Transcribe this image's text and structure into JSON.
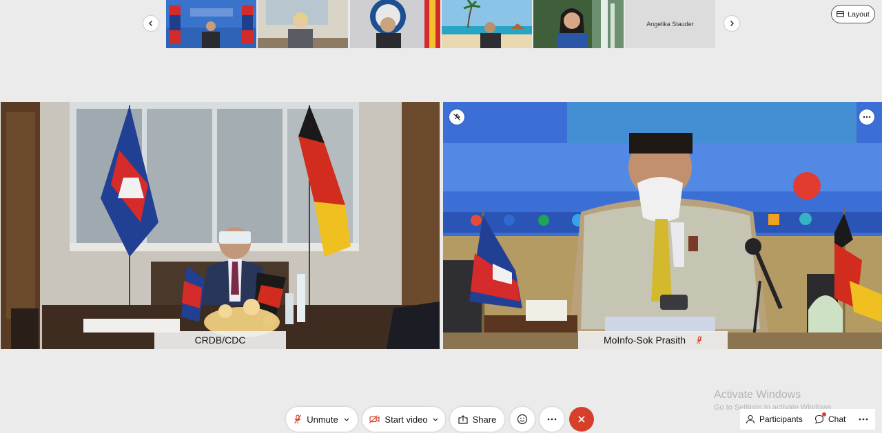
{
  "filmstrip": {
    "participants": [
      "",
      "",
      "",
      "",
      "",
      "Angelika Stauder"
    ]
  },
  "layout_button": {
    "label": "Layout",
    "icon": "layout-icon"
  },
  "main_tiles": [
    {
      "name": "CRDB/CDC"
    },
    {
      "name": "MoInfo-Sok Prasith",
      "muted": true,
      "muted_icon": "mic-off-icon"
    }
  ],
  "toolbar": {
    "unmute": "Unmute",
    "start_video": "Start video",
    "share": "Share",
    "reactions_icon": "smiley-icon",
    "more_icon": "more-icon",
    "end_icon": "close-icon"
  },
  "right_toolbar": {
    "participants": "Participants",
    "chat": "Chat"
  },
  "watermark": {
    "line1": "Activate Windows",
    "line2": "Go to Settings to activate Windows."
  },
  "colors": {
    "end_call": "#d6402b",
    "muted_red": "#d6402b",
    "accent": "#0a7cd6"
  }
}
